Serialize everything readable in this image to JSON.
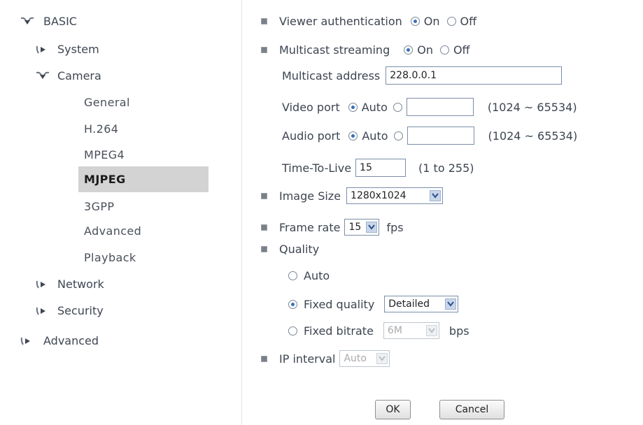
{
  "sidebar": {
    "basic": "BASIC",
    "system": "System",
    "camera": "Camera",
    "camera_items": [
      "General",
      "H.264",
      "MPEG4",
      "MJPEG",
      "3GPP",
      "Advanced",
      "Playback"
    ],
    "network": "Network",
    "security": "Security",
    "advanced": "Advanced"
  },
  "form": {
    "viewer_auth": {
      "label": "Viewer authentication",
      "on": "On",
      "off": "Off",
      "selected": "On"
    },
    "multicast": {
      "label": "Multicast streaming",
      "on": "On",
      "off": "Off",
      "selected": "On"
    },
    "multicast_address": {
      "label": "Multicast address",
      "value": "228.0.0.1"
    },
    "video_port": {
      "label": "Video port",
      "auto": "Auto",
      "value": "",
      "range": "(1024 ~ 65534)"
    },
    "audio_port": {
      "label": "Audio port",
      "auto": "Auto",
      "value": "",
      "range": "(1024 ~ 65534)"
    },
    "ttl": {
      "label": "Time-To-Live",
      "value": "15",
      "range": "(1 to 255)"
    },
    "image_size": {
      "label": "Image Size",
      "value": "1280x1024"
    },
    "frame_rate": {
      "label": "Frame rate",
      "value": "15",
      "unit": "fps"
    },
    "quality": {
      "label": "Quality",
      "auto": "Auto",
      "fixed_quality": "Fixed quality",
      "fixed_quality_value": "Detailed",
      "fixed_bitrate": "Fixed bitrate",
      "fixed_bitrate_value": "6M",
      "bitrate_unit": "bps",
      "selected": "Fixed quality"
    },
    "ip_interval": {
      "label": "IP interval",
      "value": "Auto"
    }
  },
  "buttons": {
    "ok": "OK",
    "cancel": "Cancel"
  },
  "colors": {
    "active_bg": "#d3d3d3",
    "radio_dot": "#3b6fb5",
    "chevron_bg": "#c9d6ea"
  }
}
